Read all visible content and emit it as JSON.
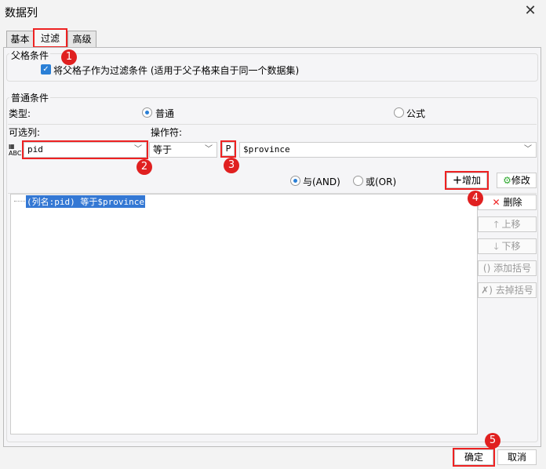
{
  "window": {
    "title": "数据列",
    "close": "✕"
  },
  "tabs": [
    {
      "label": "基本"
    },
    {
      "label": "过滤"
    },
    {
      "label": "高级"
    }
  ],
  "parent": {
    "title": "父格条件",
    "checkbox_label": "将父格子作为过滤条件 (适用于父子格来自于同一个数据集)",
    "checked": true
  },
  "normal": {
    "title": "普通条件",
    "type_label": "类型:",
    "type_options": [
      "普通",
      "公式"
    ],
    "selected_type": "普通",
    "column_label": "可选列:",
    "operator_label": "操作符:",
    "column_value": "pid",
    "operator_value": "等于",
    "param_icon": "P",
    "value": "$province"
  },
  "logic": {
    "and_label": "与(AND)",
    "or_label": "或(OR)",
    "selected": "AND"
  },
  "buttons": {
    "add": "增加",
    "edit": "修改",
    "delete": "删除",
    "up": "上移",
    "down": "下移",
    "add_paren": "添加括号",
    "remove_paren": "去掉括号",
    "ok": "确定",
    "cancel": "取消"
  },
  "conditions": [
    "(列名:pid) 等于$province"
  ],
  "badges": [
    "1",
    "2",
    "3",
    "4",
    "5"
  ]
}
